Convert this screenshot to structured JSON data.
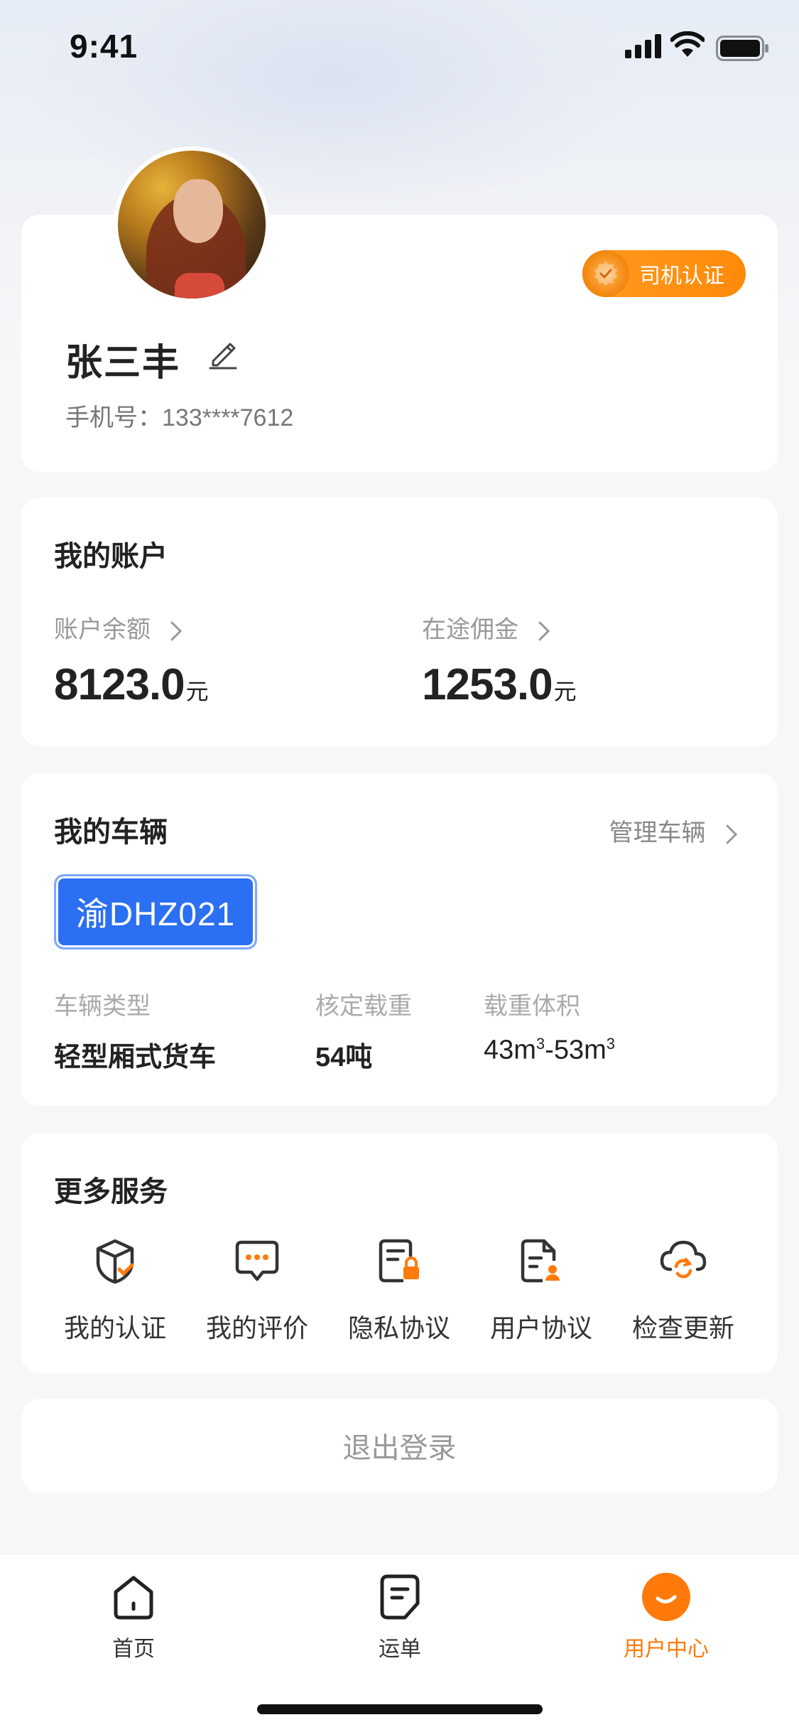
{
  "status_bar": {
    "time": "9:41"
  },
  "profile": {
    "name": "张三丰",
    "phone": "手机号：133****7612",
    "badge_label": "司机认证"
  },
  "account": {
    "title": "我的账户",
    "balance_label": "账户余额",
    "balance_value": "8123.0",
    "commission_label": "在途佣金",
    "commission_value": "1253.0",
    "unit": "元"
  },
  "vehicle": {
    "title": "我的车辆",
    "manage_label": "管理车辆",
    "plate": "渝DHZ021",
    "type_label": "车辆类型",
    "type_value": "轻型厢式货车",
    "load_label": "核定载重",
    "load_value": "54吨",
    "volume_label": "载重体积",
    "volume_value_a": "43m",
    "volume_value_b": "-53m",
    "volume_sup": "3"
  },
  "services": {
    "title": "更多服务",
    "items": [
      {
        "label": "我的认证",
        "icon": "certification-icon"
      },
      {
        "label": "我的评价",
        "icon": "comment-icon"
      },
      {
        "label": "隐私协议",
        "icon": "privacy-doc-icon"
      },
      {
        "label": "用户协议",
        "icon": "user-doc-icon"
      },
      {
        "label": "检查更新",
        "icon": "cloud-refresh-icon"
      }
    ]
  },
  "logout_label": "退出登录",
  "tabbar": {
    "items": [
      {
        "label": "首页",
        "icon": "home-icon",
        "active": false
      },
      {
        "label": "运单",
        "icon": "waybill-icon",
        "active": false
      },
      {
        "label": "用户中心",
        "icon": "user-center-icon",
        "active": true
      }
    ]
  },
  "colors": {
    "accent": "#ff7a0a",
    "plate_blue": "#2b6ff2",
    "text_primary": "#222222",
    "text_secondary": "#999999"
  }
}
